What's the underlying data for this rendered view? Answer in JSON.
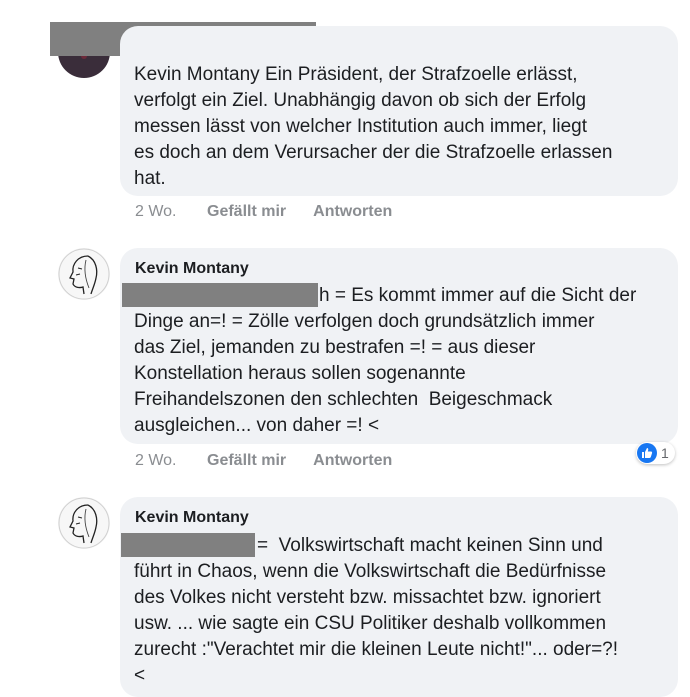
{
  "comments": [
    {
      "lines": [
        "Kevin Montany Ein Präsident, der Strafzoelle erlässt,",
        "verfolgt ein Ziel. Unabhängig davon ob sich der Erfolg",
        "messen lässt von welcher Institution auch immer, liegt",
        "es doch an dem Verursacher der die Strafzoelle erlassen",
        "hat."
      ],
      "age": "2 Wo.",
      "like_label": "Gefällt mir",
      "reply_label": "Antworten"
    },
    {
      "author": "Kevin Montany",
      "first_line_tail": "h = Es kommt immer auf die Sicht der",
      "lines": [
        "Dinge an=! = Zölle verfolgen doch grundsätzlich immer",
        "das Ziel, jemanden zu bestrafen =! = aus dieser",
        "Konstellation heraus sollen sogenannte",
        "Freihandelszonen den schlechten  Beigeschmack",
        "ausgleichen... von daher =! <"
      ],
      "age": "2 Wo.",
      "like_label": "Gefällt mir",
      "reply_label": "Antworten",
      "reaction_count": "1",
      "reaction_icon": "thumbs-up-icon",
      "reaction_color": "#1877f2"
    },
    {
      "author": "Kevin Montany",
      "first_line_tail": "=  Volkswirtschaft macht keinen Sinn und",
      "lines": [
        "führt in Chaos, wenn die Volkswirtschaft die Bedürfnisse",
        "des Volkes nicht versteht bzw. missachtet bzw. ignoriert",
        "usw. ... wie sagte ein CSU Politiker deshalb vollkommen",
        "zurecht :\"Verachtet mir die kleinen Leute nicht!\"... oder=?!",
        "<"
      ]
    }
  ],
  "colors": {
    "bubble": "#f0f2f5",
    "redaction": "#808080",
    "meta_text": "#8a8d91"
  }
}
